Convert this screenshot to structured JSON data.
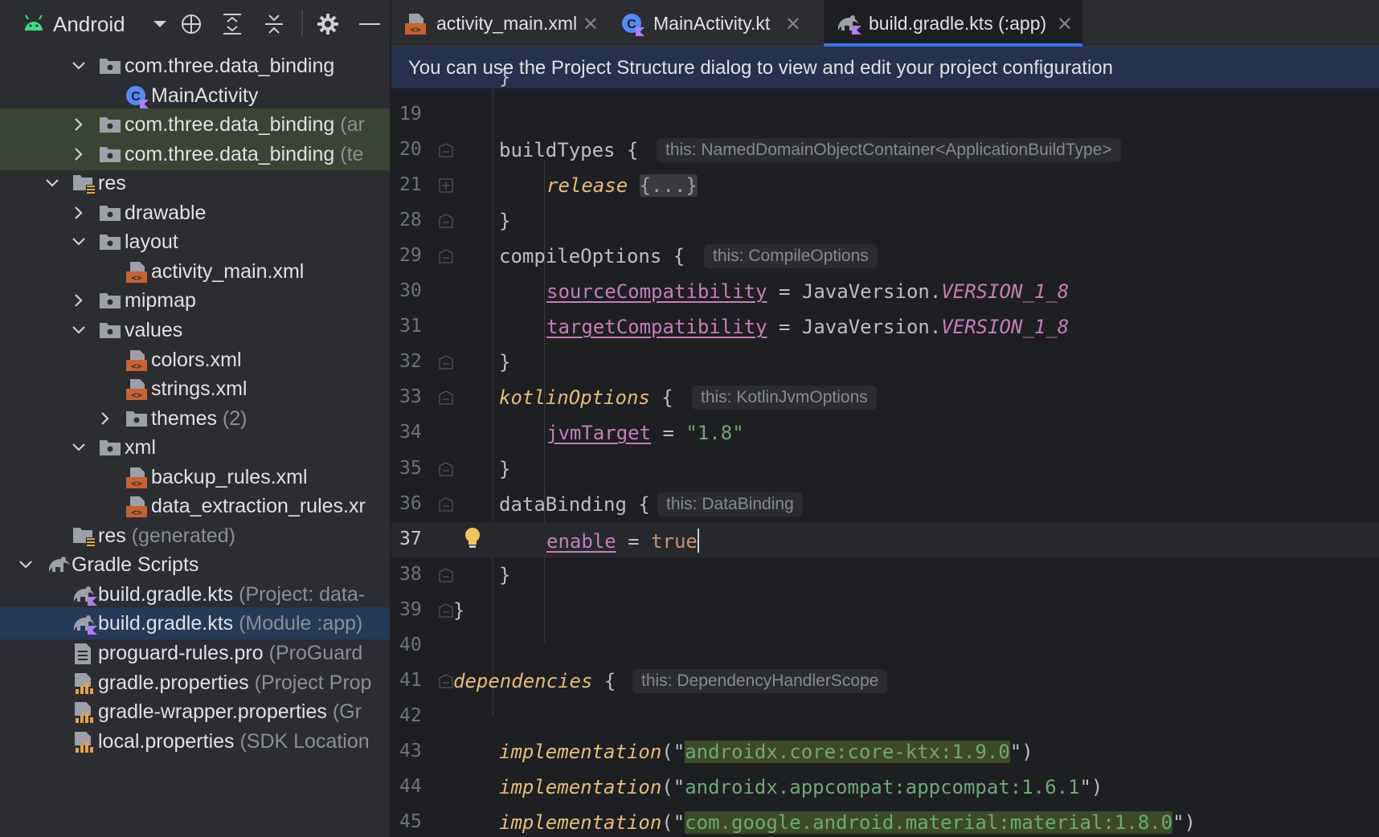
{
  "project_panel": {
    "title": "Android",
    "toolbar_icons": [
      "crosshair-icon",
      "expand-all-icon",
      "collapse-all-icon",
      "gear-icon",
      "minimize-icon"
    ]
  },
  "tree": [
    {
      "label": "com.three.data_binding",
      "hint": "",
      "depth": 2,
      "chevron": "down",
      "icon": "package-icon"
    },
    {
      "label": "MainActivity",
      "hint": "",
      "depth": 3,
      "chevron": "",
      "icon": "kotlin-class-icon"
    },
    {
      "label": "com.three.data_binding",
      "hint": " (ar",
      "depth": 2,
      "chevron": "right",
      "icon": "package-icon",
      "highlight": true
    },
    {
      "label": "com.three.data_binding",
      "hint": " (te",
      "depth": 2,
      "chevron": "right",
      "icon": "package-icon",
      "highlight": true
    },
    {
      "label": "res",
      "hint": "",
      "depth": 1,
      "chevron": "down",
      "icon": "res-folder-icon"
    },
    {
      "label": "drawable",
      "hint": "",
      "depth": 2,
      "chevron": "right",
      "icon": "folder-icon"
    },
    {
      "label": "layout",
      "hint": "",
      "depth": 2,
      "chevron": "down",
      "icon": "folder-icon"
    },
    {
      "label": "activity_main.xml",
      "hint": "",
      "depth": 3,
      "chevron": "",
      "icon": "xml-file-icon"
    },
    {
      "label": "mipmap",
      "hint": "",
      "depth": 2,
      "chevron": "right",
      "icon": "folder-icon"
    },
    {
      "label": "values",
      "hint": "",
      "depth": 2,
      "chevron": "down",
      "icon": "folder-icon"
    },
    {
      "label": "colors.xml",
      "hint": "",
      "depth": 3,
      "chevron": "",
      "icon": "xml-file-icon"
    },
    {
      "label": "strings.xml",
      "hint": "",
      "depth": 3,
      "chevron": "",
      "icon": "xml-file-icon"
    },
    {
      "label": "themes",
      "hint": " (2)",
      "depth": 3,
      "chevron": "right",
      "icon": "folder-icon"
    },
    {
      "label": "xml",
      "hint": "",
      "depth": 2,
      "chevron": "down",
      "icon": "folder-icon"
    },
    {
      "label": "backup_rules.xml",
      "hint": "",
      "depth": 3,
      "chevron": "",
      "icon": "xml-file-icon"
    },
    {
      "label": "data_extraction_rules.xr",
      "hint": "",
      "depth": 3,
      "chevron": "",
      "icon": "xml-file-icon"
    },
    {
      "label": "res",
      "hint": " (generated)",
      "depth": 1,
      "chevron": "",
      "icon": "res-folder-icon"
    },
    {
      "label": "Gradle Scripts",
      "hint": "",
      "depth": 0,
      "chevron": "down",
      "icon": "gradle-icon"
    },
    {
      "label": "build.gradle.kts",
      "hint": " (Project: data-",
      "depth": 1,
      "chevron": "",
      "icon": "gradle-kts-icon"
    },
    {
      "label": "build.gradle.kts",
      "hint": " (Module :app)",
      "depth": 1,
      "chevron": "",
      "icon": "gradle-kts-icon",
      "selected": true
    },
    {
      "label": "proguard-rules.pro",
      "hint": " (ProGuard",
      "depth": 1,
      "chevron": "",
      "icon": "text-file-icon"
    },
    {
      "label": "gradle.properties",
      "hint": " (Project Prop",
      "depth": 1,
      "chevron": "",
      "icon": "properties-file-icon"
    },
    {
      "label": "gradle-wrapper.properties",
      "hint": " (Gr",
      "depth": 1,
      "chevron": "",
      "icon": "properties-file-icon"
    },
    {
      "label": "local.properties",
      "hint": " (SDK Location",
      "depth": 1,
      "chevron": "",
      "icon": "properties-file-icon"
    }
  ],
  "tabs": [
    {
      "label": "activity_main.xml",
      "icon": "xml-file-icon",
      "active": false
    },
    {
      "label": "MainActivity.kt",
      "icon": "kotlin-class-icon",
      "active": false
    },
    {
      "label": "build.gradle.kts (:app)",
      "icon": "gradle-kts-icon",
      "active": true
    }
  ],
  "tab_close_glyph": "✕",
  "banner": "You can use the Project Structure dialog to view and edit your project configuration",
  "code": {
    "top_partial": "}",
    "lines": [
      {
        "n": "19"
      },
      {
        "n": "20",
        "text": "buildTypes {",
        "hint": "this: NamedDomainObjectContainer<ApplicationBuildType>"
      },
      {
        "n": "21",
        "text_fn": "release",
        "folded": "{...}"
      },
      {
        "n": "28",
        "text": "}"
      },
      {
        "n": "29",
        "text": "compileOptions {",
        "hint": "this: CompileOptions"
      },
      {
        "n": "30",
        "prop": "sourceCompatibility",
        "eq": " = JavaVersion.",
        "const": "VERSION_1_8"
      },
      {
        "n": "31",
        "prop": "targetCompatibility",
        "eq": " = JavaVersion.",
        "const": "VERSION_1_8"
      },
      {
        "n": "32",
        "text": "}"
      },
      {
        "n": "33",
        "text_fn": "kotlinOptions",
        "after": " {",
        "hint": "this: KotlinJvmOptions"
      },
      {
        "n": "34",
        "prop": "jvmTarget",
        "eq": " = ",
        "str": "\"1.8\""
      },
      {
        "n": "35",
        "text": "}"
      },
      {
        "n": "36",
        "text": "dataBinding {",
        "hint": "this: DataBinding"
      },
      {
        "n": "37",
        "prop": "enable",
        "eq": " = ",
        "bool": "true"
      },
      {
        "n": "38",
        "text": "}"
      },
      {
        "n": "39",
        "text": "}"
      },
      {
        "n": "40"
      },
      {
        "n": "41",
        "text_fn": "dependencies",
        "after": " {",
        "hint": "this: DependencyHandlerScope"
      },
      {
        "n": "42"
      },
      {
        "n": "43",
        "impl": "implementation",
        "dep": "androidx.core:core-ktx:1.9.0"
      },
      {
        "n": "44",
        "impl": "implementation",
        "dep": "androidx.appcompat:appcompat:1.6.1"
      },
      {
        "n": "45",
        "impl": "implementation",
        "dep": "com.google.android.material:material:1.8.0"
      }
    ]
  },
  "colors": {
    "accent": "#3574f0",
    "banner_bg": "#25324d",
    "selected_row": "#253958",
    "keyword_fn": "#e8bc73",
    "property": "#c77dbb",
    "string": "#6aab73",
    "boolean": "#cf8e6d",
    "bulb": "#f2c55c"
  }
}
